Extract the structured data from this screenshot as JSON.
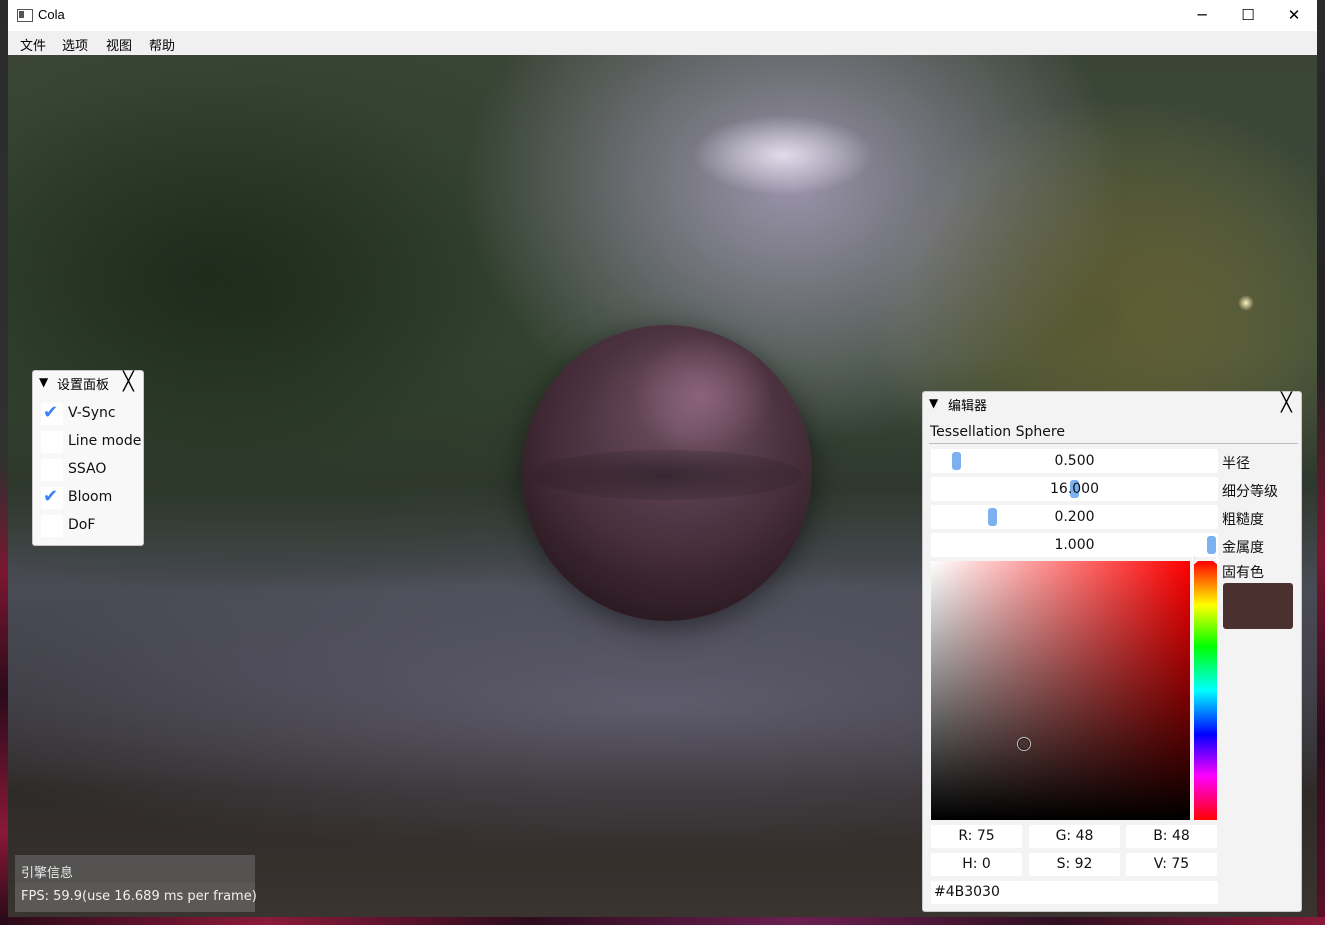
{
  "window": {
    "title": "Cola",
    "minimize_glyph": "─",
    "maximize_glyph": "☐",
    "close_glyph": "✕"
  },
  "menu": [
    "文件",
    "选项",
    "视图",
    "帮助"
  ],
  "settings_panel": {
    "title": "设置面板",
    "close_glyph": "╳",
    "collapse_glyph": "▼",
    "items": [
      {
        "label": "V-Sync",
        "checked": true
      },
      {
        "label": "Line mode",
        "checked": false
      },
      {
        "label": "SSAO",
        "checked": false
      },
      {
        "label": "Bloom",
        "checked": true
      },
      {
        "label": "DoF",
        "checked": false
      }
    ],
    "check_glyph": "✔"
  },
  "engine_info": {
    "title": "引擎信息",
    "fps": "FPS: 59.9(use 16.689 ms per frame)"
  },
  "editor": {
    "title": "编辑器",
    "collapse_glyph": "▼",
    "close_glyph": "╳",
    "object_name": "Tessellation Sphere",
    "sliders": [
      {
        "value": "0.500",
        "label": "半径",
        "fraction": 0.07
      },
      {
        "value": "16.000",
        "label": "细分等级",
        "fraction": 0.5
      },
      {
        "value": "0.200",
        "label": "粗糙度",
        "fraction": 0.2
      },
      {
        "value": "1.000",
        "label": "金属度",
        "fraction": 1.0
      }
    ],
    "color_label": "固有色",
    "color_hex_value": "#4B3030",
    "rgb": {
      "r": "R: 75",
      "g": "G: 48",
      "b": "B: 48"
    },
    "hsv": {
      "h": "H:  0",
      "s": "S: 92",
      "v": "V: 75"
    },
    "hex_text": "#4B3030"
  }
}
